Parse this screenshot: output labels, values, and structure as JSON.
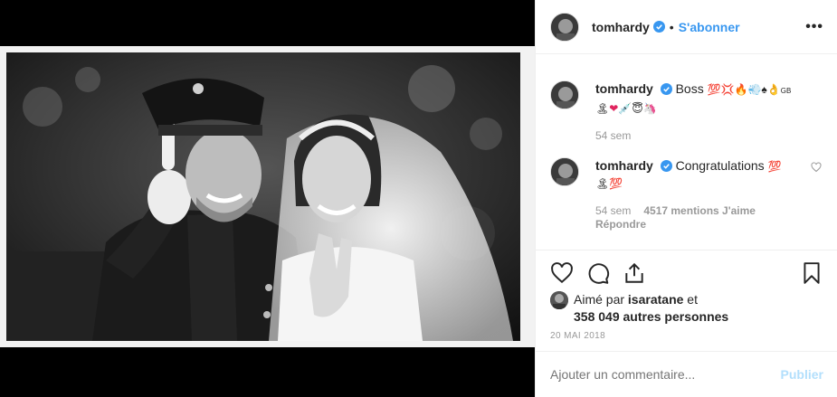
{
  "post": {
    "author": "tomhardy",
    "dot": "•",
    "follow_label": "S'abonner",
    "more_label": "•••"
  },
  "comments": [
    {
      "user": "tomhardy",
      "text": "Boss",
      "emojis": [
        "💯",
        "💢",
        "🔥",
        "💨",
        "♠",
        "👌"
      ],
      "suffix": "GB",
      "emojis_line2": [
        "🏝",
        "❤",
        "💉",
        "😇",
        "🦄"
      ],
      "time": "54 sem"
    },
    {
      "user": "tomhardy",
      "text": "Congratulations",
      "emojis": [
        "💯"
      ],
      "emojis_line2": [
        "🏝",
        "💯"
      ],
      "time": "54 sem",
      "likes": "4517 mentions J'aime",
      "reply_label": "Répondre"
    }
  ],
  "likes": {
    "prefix": "Aimé par",
    "user": "isaratane",
    "conj": "et",
    "count_text": "358 049 autres personnes"
  },
  "date": "20 MAI 2018",
  "add_comment": {
    "placeholder": "Ajouter un commentaire...",
    "publish_label": "Publier"
  },
  "icons": {
    "like": "heart-icon",
    "comment": "comment-bubble-icon",
    "share": "share-icon",
    "save": "bookmark-icon",
    "verified": "verified-badge-icon"
  },
  "colors": {
    "link_blue": "#3897f0",
    "publish_disabled": "#b2dffc",
    "muted": "#999999",
    "border": "#efefef"
  }
}
